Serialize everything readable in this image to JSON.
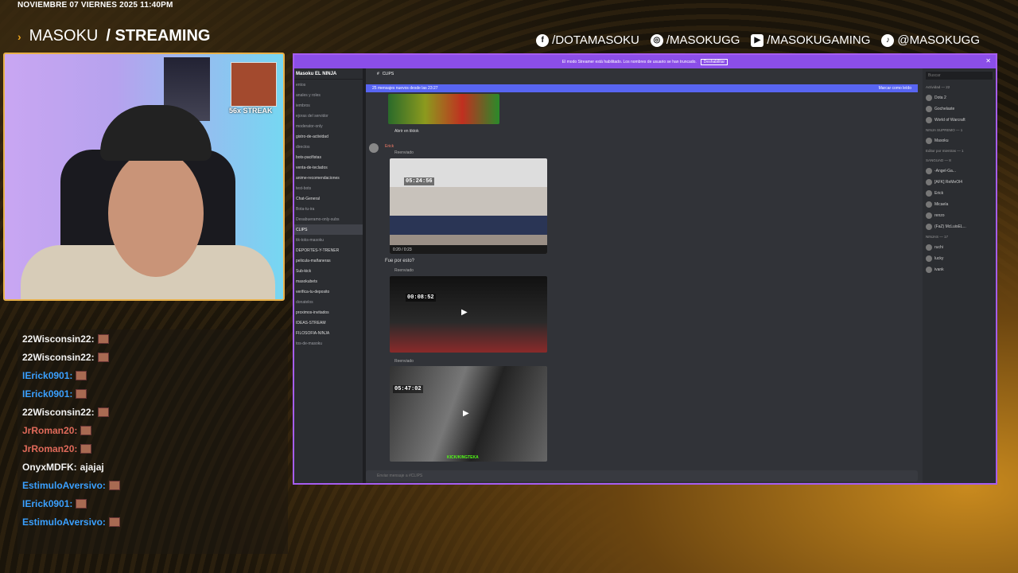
{
  "overlay": {
    "date": "NOVIEMBRE 07 VIERNES 2025 11:40PM",
    "brand_name": "MASOKU",
    "brand_suffix": "/ STREAMING",
    "socials": [
      "/DOTAMASOKU",
      "/MASOKUGG",
      "/MASOKUGAMING",
      "@MASOKUGG"
    ],
    "streak": "56x STREAK"
  },
  "chat": [
    {
      "user": "22Wisconsin22:",
      "text": "",
      "color": "#f2f2f2"
    },
    {
      "user": "22Wisconsin22:",
      "text": "",
      "color": "#f2f2f2"
    },
    {
      "user": "IErick0901:",
      "text": "",
      "color": "#3aa0ff"
    },
    {
      "user": "IErick0901:",
      "text": "",
      "color": "#3aa0ff"
    },
    {
      "user": "22Wisconsin22:",
      "text": "",
      "color": "#f2f2f2"
    },
    {
      "user": "JrRoman20:",
      "text": "",
      "color": "#e06a5a"
    },
    {
      "user": "JrRoman20:",
      "text": "",
      "color": "#e06a5a"
    },
    {
      "user": "OnyxMDFK:",
      "text": "ajajaj",
      "color": "#f2f2f2"
    },
    {
      "user": "EstimuloAversivo:",
      "text": "",
      "color": "#3aa0ff"
    },
    {
      "user": "IErick0901:",
      "text": "",
      "color": "#3aa0ff"
    },
    {
      "user": "EstimuloAversivo:",
      "text": "",
      "color": "#3aa0ff"
    }
  ],
  "discord": {
    "banner_text": "El modo Streamer está habilitado. Los nombres de usuario se han truncado.",
    "banner_button": "Deshabilitar",
    "server_name": "Masoku EL NINJA",
    "channel_name": "CLIPS",
    "new_messages": "25 mensajes nuevos desde las 23:27",
    "mark_read": "Marcar como leído",
    "open_tiktok": "Abrir en tiktok",
    "author": "Erick",
    "question": "Fue por esto?",
    "resend_label": "Reenviado",
    "timestamps": [
      "05:24:56",
      "00:08:52",
      "05:47:02"
    ],
    "video_time": "0:20 / 0:23",
    "watermark": "KICK/KINGTEKA",
    "composer_placeholder": "Enviar mensaje a #CLIPS",
    "channels": [
      {
        "label": "entos",
        "state": ""
      },
      {
        "label": "anales y roles",
        "state": ""
      },
      {
        "label": "iembros",
        "state": ""
      },
      {
        "label": "ejoras del servidor",
        "state": ""
      },
      {
        "label": "moderator-only",
        "state": ""
      },
      {
        "label": "gistro-de-actividad",
        "state": "hi"
      },
      {
        "label": "directos",
        "state": ""
      },
      {
        "label": "bots-pacifistas",
        "state": "hi"
      },
      {
        "label": "venta-de-teclados",
        "state": "hi"
      },
      {
        "label": "anime-recomendaciones",
        "state": "hi"
      },
      {
        "label": "test-bots",
        "state": ""
      },
      {
        "label": "Chat-General",
        "state": "hi"
      },
      {
        "label": "Bota-tu-ira",
        "state": ""
      },
      {
        "label": "Desabueramo-only-subs",
        "state": ""
      },
      {
        "label": "CLIPS",
        "state": "sel"
      },
      {
        "label": "tik-toks-masoku",
        "state": ""
      },
      {
        "label": "DEPORTES-Y-TRENER",
        "state": "hi"
      },
      {
        "label": "pelicula-mañaneras",
        "state": "hi"
      },
      {
        "label": "Sub-kick",
        "state": "hi"
      },
      {
        "label": "masokubets",
        "state": "hi"
      },
      {
        "label": "verifica-tu-deposito",
        "state": "hi"
      },
      {
        "label": "donatelos",
        "state": ""
      },
      {
        "label": "proximos-invitados",
        "state": "hi"
      },
      {
        "label": "IDEAS-STREAM",
        "state": "hi"
      },
      {
        "label": "FILOSOFIA-NINJA",
        "state": "hi"
      },
      {
        "label": "tos-de-masoku",
        "state": ""
      }
    ],
    "members": {
      "search": "Buscar",
      "activity": "Actividad — 22",
      "groups": [
        {
          "title": "NINJA SUPREMO — 1",
          "names": [
            "Masoku"
          ]
        },
        {
          "title": "Editor por mientras — 1",
          "names": []
        },
        {
          "title": "SANGUAD — 8",
          "names": [
            "-Angel-Ga...",
            "[AFK] ReMeOl4",
            "Erick",
            "Micaela",
            "renzo",
            "(FaZ) McLuisEL..."
          ]
        },
        {
          "title": "NINJAS — 17",
          "names": [
            "ruchi",
            "lucky",
            "ivank"
          ]
        }
      ],
      "games": [
        "Dota 2",
        "Gochelaste",
        "World of Warcraft"
      ]
    }
  }
}
